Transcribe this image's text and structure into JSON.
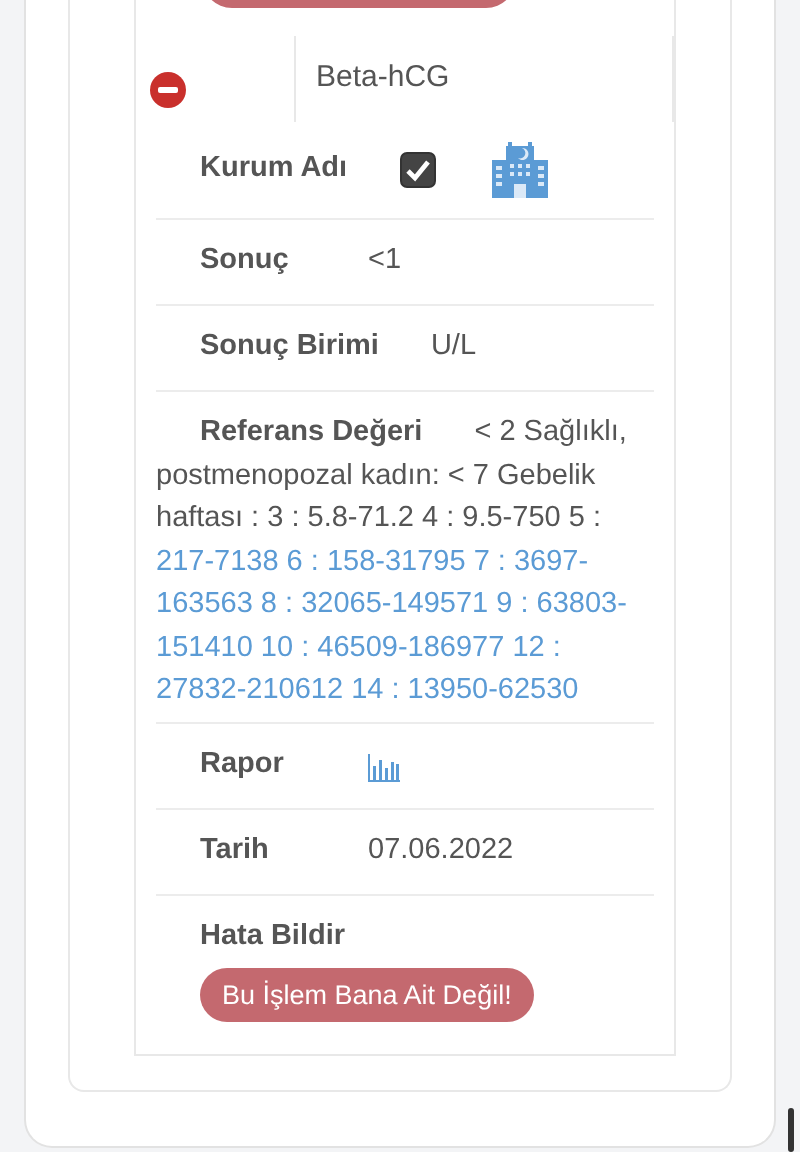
{
  "test": {
    "name": "Beta-hCG"
  },
  "fields": [
    {
      "kind": "institution",
      "label": "Kurum Adı",
      "checked": true
    },
    {
      "kind": "text",
      "label": "Sonuç",
      "value": "<1"
    },
    {
      "kind": "text",
      "label": "Sonuç Birimi",
      "value": "U/L"
    },
    {
      "kind": "reference",
      "label": "Referans Değeri",
      "value": "< 2 Sağlıklı, postmenopozal kadın: < 7 Gebelik haftası : 3 : 5.8-71.2 4 : 9.5-750 5 :",
      "highlighted": "217-7138 6 : 158-31795 7 : 3697-163563 8 : 32065-149571 9 : 63803-151410 10 : 46509-186977 12 : 27832-210612 14 : 13950-62530"
    },
    {
      "kind": "report",
      "label": "Rapor"
    },
    {
      "kind": "text",
      "label": "Tarih",
      "value": "07.06.2022"
    },
    {
      "kind": "action",
      "label": "Hata Bildir",
      "button": "Bu İşlem Bana Ait Değil!"
    }
  ]
}
